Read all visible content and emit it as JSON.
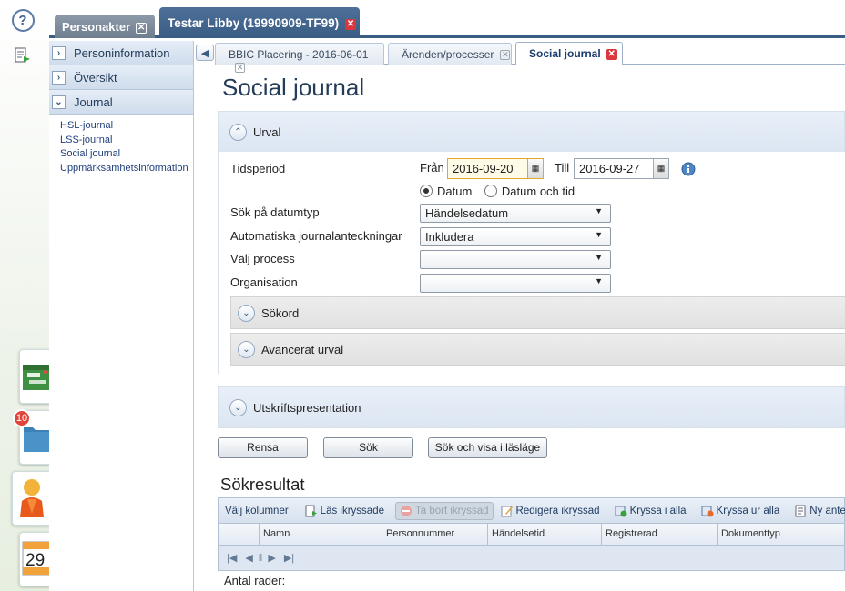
{
  "top_tabs": [
    {
      "label": "Personakter",
      "active": false
    },
    {
      "label": "Testar Libby (19990909-TF99)",
      "active": true
    }
  ],
  "left_rail": {
    "badge_count": "10",
    "calendar_day": "29"
  },
  "sidebar": {
    "sections": [
      {
        "label": "Personinformation",
        "expanded": false
      },
      {
        "label": "Översikt",
        "expanded": false
      },
      {
        "label": "Journal",
        "expanded": true
      }
    ],
    "links": [
      "HSL-journal",
      "LSS-journal",
      "Social journal",
      "Uppmärksamhetsinformation"
    ]
  },
  "sub_tabs": [
    {
      "label": "BBIC Placering - 2016-06-01",
      "active": false
    },
    {
      "label": "Ärenden/processer",
      "active": false
    },
    {
      "label": "Social journal",
      "active": true
    }
  ],
  "page_title": "Social journal",
  "urval": {
    "title": "Urval",
    "tidsperiod_label": "Tidsperiod",
    "fran_label": "Från",
    "fran_value": "2016-09-20",
    "till_label": "Till",
    "till_value": "2016-09-27",
    "radio_datum": "Datum",
    "radio_datum_tid": "Datum och tid",
    "datumtyp_label": "Sök på datumtyp",
    "datumtyp_value": "Händelsedatum",
    "auto_label": "Automatiska journalanteckningar",
    "auto_value": "Inkludera",
    "process_label": "Välj process",
    "process_value": "",
    "org_label": "Organisation",
    "org_value": "",
    "sokord_title": "Sökord",
    "avancerat_title": "Avancerat urval"
  },
  "utskrift_title": "Utskriftspresentation",
  "buttons": {
    "rensa": "Rensa",
    "sok": "Sök",
    "sok_visa": "Sök och visa i läsläge"
  },
  "results": {
    "title": "Sökresultat",
    "toolbar": {
      "valj": "Välj kolumner",
      "las": "Läs ikryssade",
      "ta_bort": "Ta bort ikryssad",
      "redigera": "Redigera ikryssad",
      "kryssa_alla": "Kryssa i alla",
      "kryssa_ur": "Kryssa ur alla",
      "ny": "Ny anteckning"
    },
    "columns": [
      "Namn",
      "Personnummer",
      "Händelsetid",
      "Registrerad",
      "Dokumenttyp"
    ],
    "antal_label": "Antal rader:"
  },
  "colors": {
    "brand_blue": "#3a5d84",
    "title_blue": "#243c5a",
    "close_red": "#d9363e",
    "badge_red": "#e0453b"
  }
}
